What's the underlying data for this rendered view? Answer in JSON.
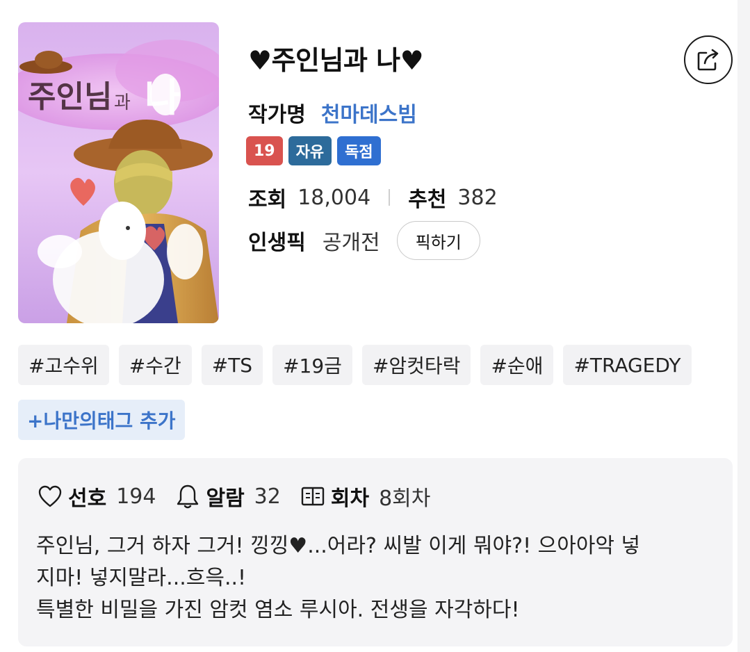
{
  "novel": {
    "title": "♥주인님과 나♥",
    "author_label": "작가명",
    "author_name": "천마데스빔",
    "badges": [
      {
        "text": "19",
        "color": "#d9534f"
      },
      {
        "text": "자유",
        "color": "#2d6b9b"
      },
      {
        "text": "독점",
        "color": "#2f6fd1"
      }
    ],
    "views_label": "조회",
    "views": "18,004",
    "recommend_label": "추천",
    "recommend": "382",
    "pick_label": "인생픽",
    "pick_status": "공개전",
    "pick_button": "픽하기"
  },
  "cover": {
    "title_text_a": "주인님",
    "title_text_b": "과",
    "title_text_c": "나"
  },
  "icons": {
    "share": "share-icon",
    "like": "heart-outline-icon",
    "alarm": "bell-icon",
    "episodes": "book-icon"
  },
  "tags": [
    "#고수위",
    "#수간",
    "#TS",
    "#19금",
    "#암컷타락",
    "#순애",
    "#TRAGEDY"
  ],
  "add_tag_label": "+나만의태그 추가",
  "summary": {
    "like_label": "선호",
    "like_count": "194",
    "alarm_label": "알람",
    "alarm_count": "32",
    "episode_label": "회차",
    "episode_count": "8회차",
    "lines": [
      "주인님, 그거 하자 그거! 낑낑♥...어라? 씨발 이게 뭐야?! 으아아악 넣",
      "지마! 넣지말라...흐윽..!",
      "특별한 비밀을 가진 암컷 염소 루시아. 전생을 자각하다!"
    ]
  },
  "colors": {
    "accent": "#3c74c9",
    "tag_bg": "#f2f2f4",
    "summary_bg": "#f4f4f6"
  }
}
